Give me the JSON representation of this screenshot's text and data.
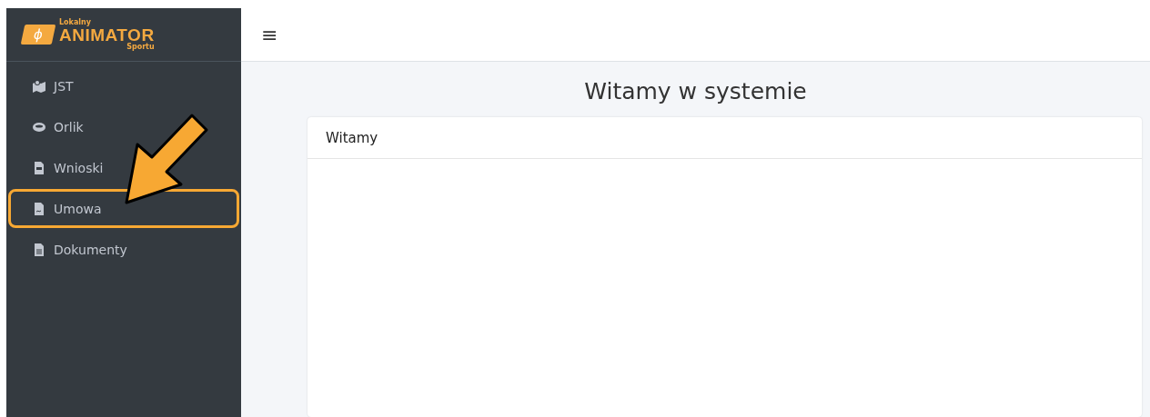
{
  "logo": {
    "symbol": "ϕ",
    "top": "Lokalny",
    "main": "ANIMATOR",
    "bottom": "Sportu"
  },
  "sidebar": {
    "items": [
      {
        "label": "JST",
        "highlighted": false
      },
      {
        "label": "Orlik",
        "highlighted": false
      },
      {
        "label": "Wnioski",
        "highlighted": false
      },
      {
        "label": "Umowa",
        "highlighted": true
      },
      {
        "label": "Dokumenty",
        "highlighted": false
      }
    ]
  },
  "header": {
    "menu_icon": "≡"
  },
  "page_title": "Witamy w systemie",
  "card": {
    "title": "Witamy"
  }
}
